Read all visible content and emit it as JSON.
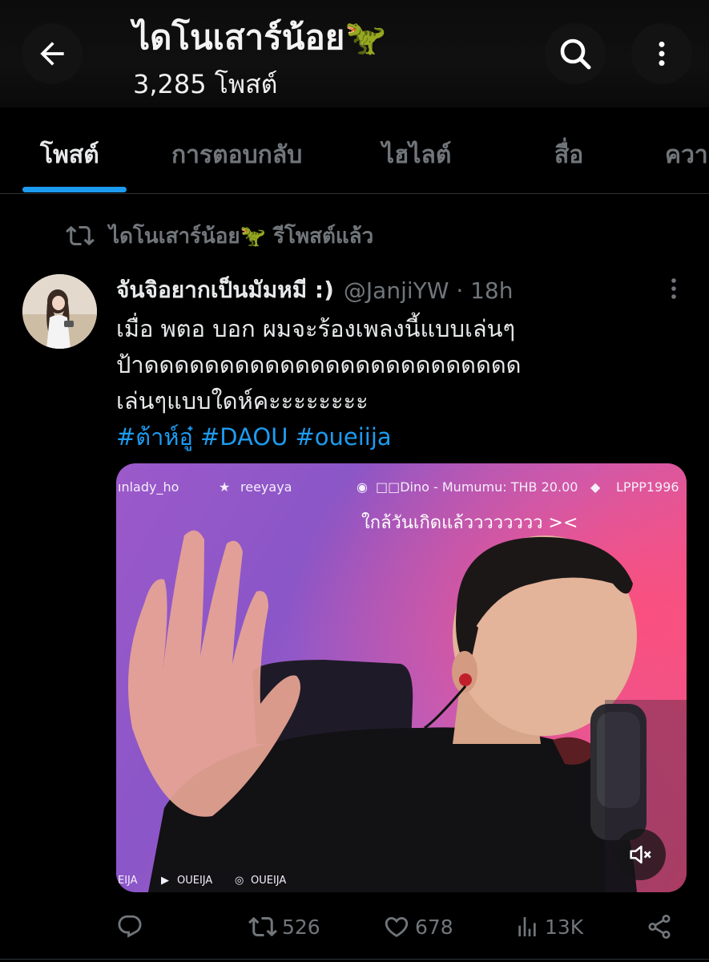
{
  "header": {
    "title": "ไดโนเสาร์น้อย🦖",
    "subtitle": "3,285 โพสต์",
    "back_icon": "arrow-left-icon",
    "search_icon": "search-icon",
    "more_icon": "more-vertical-icon"
  },
  "tabs": [
    {
      "label": "โพสต์",
      "active": true
    },
    {
      "label": "การตอบกลับ",
      "active": false
    },
    {
      "label": "ไฮไลต์",
      "active": false
    },
    {
      "label": "สื่อ",
      "active": false
    },
    {
      "label": "ควา",
      "active": false
    }
  ],
  "repost": {
    "icon": "repost-icon",
    "text": "ไดโนเสาร์น้อย🦖 รีโพสต์แล้ว"
  },
  "post": {
    "author_name": "จันจิอยากเป็นมัมหมี :)",
    "handle_time": "@JanjiYW · 18h",
    "text_lines": [
      "เมื่อ พตอ บอก ผมจะร้องเพลงนี้แบบเล่นๆ",
      "ป้าดดดดดดดดดดดดดดดดดดดดดดดดด",
      "เล่นๆแบบใดห์คะะะะะะะะ"
    ],
    "hashtags": [
      "#ต้าห์อู๋",
      "#DAOU",
      "#oueiija"
    ],
    "media": {
      "top_overlay": [
        "ınlady_ho",
        "reeyaya",
        "□□Dino - Mumumu: THB 20.00",
        "LPPP1996"
      ],
      "caption": "ใกล้วันเกิดแล้วววววววว ><",
      "bottom_overlay": [
        "EIJA",
        "OUEIJA",
        "OUEIJA"
      ],
      "mute_icon": "volume-mute-icon"
    }
  },
  "actions": {
    "reply": {
      "icon": "reply-icon",
      "count": ""
    },
    "repost": {
      "icon": "repost-icon",
      "count": "526"
    },
    "like": {
      "icon": "heart-icon",
      "count": "678"
    },
    "views": {
      "icon": "views-icon",
      "count": "13K"
    },
    "share": {
      "icon": "share-icon"
    }
  },
  "colors": {
    "background": "#000000",
    "accent": "#1d9bf0",
    "muted_text": "#71767b",
    "primary_text": "#e7e9ea"
  }
}
